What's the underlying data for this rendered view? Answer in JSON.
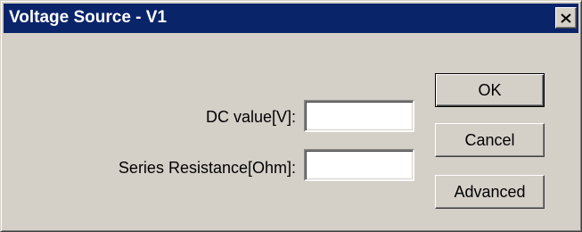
{
  "window": {
    "title": "Voltage Source - V1",
    "close_symbol": "×",
    "close_icon": "close-icon"
  },
  "form": {
    "dc_value": {
      "label": "DC value[V]:",
      "value": ""
    },
    "series_resistance": {
      "label": "Series Resistance[Ohm]:",
      "value": ""
    }
  },
  "buttons": {
    "ok": "OK",
    "cancel": "Cancel",
    "advanced": "Advanced"
  },
  "colors": {
    "titlebar": "#0a246a",
    "face": "#d4d0c8"
  }
}
